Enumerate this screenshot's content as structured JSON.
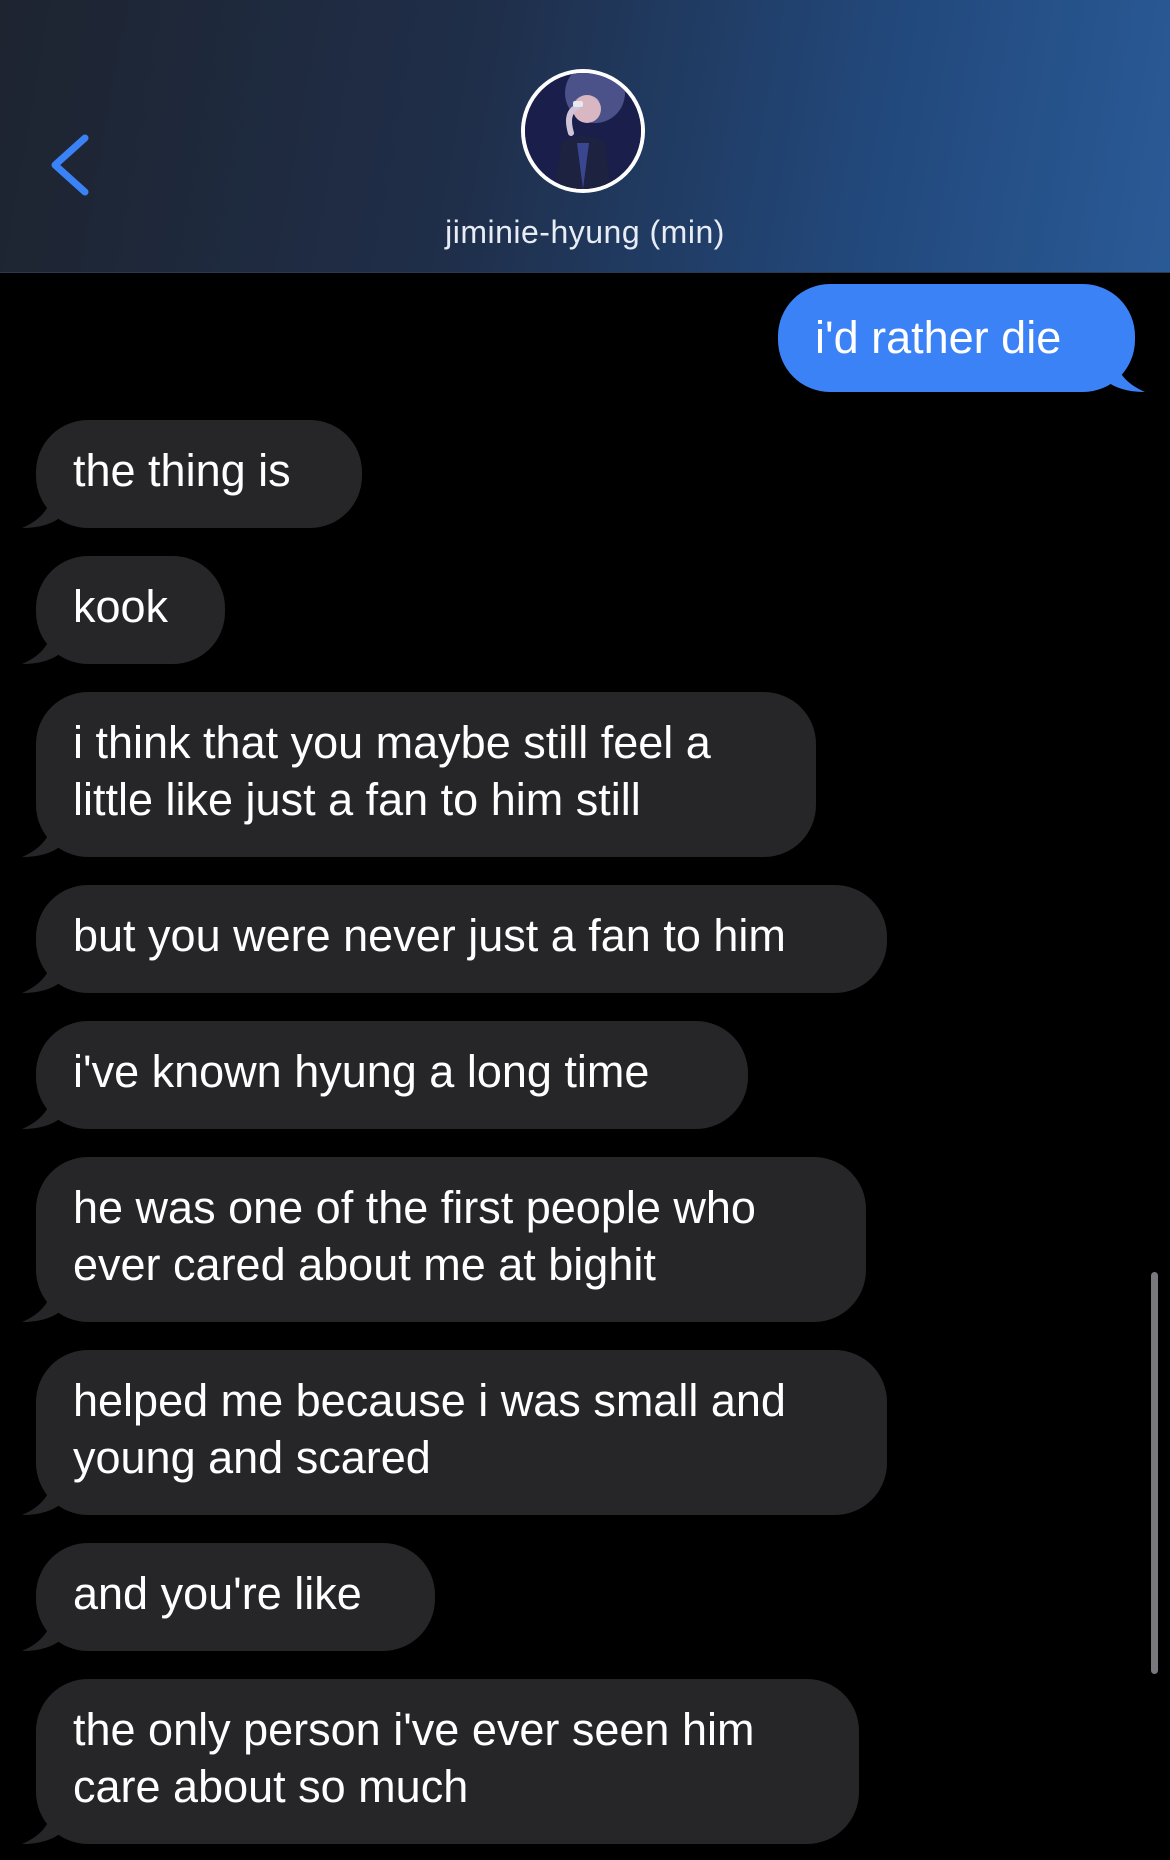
{
  "header": {
    "contact_name": "jiminie-hyung (min)",
    "back_icon": "chevron-left-icon",
    "accent_color": "#3b82f6"
  },
  "messages": [
    {
      "direction": "outgoing",
      "text": "i'd rather die"
    },
    {
      "direction": "incoming",
      "text": "the thing is"
    },
    {
      "direction": "incoming",
      "text": "kook"
    },
    {
      "direction": "incoming",
      "lines": [
        "i think that you maybe still feel a",
        "little like just a fan to him still"
      ]
    },
    {
      "direction": "incoming",
      "text": "but you were never just a fan to him"
    },
    {
      "direction": "incoming",
      "text": "i've known hyung a long time"
    },
    {
      "direction": "incoming",
      "lines": [
        "he was one of the first people who",
        "ever cared about me at bighit"
      ]
    },
    {
      "direction": "incoming",
      "lines": [
        "helped me because i was small and",
        "young and scared"
      ]
    },
    {
      "direction": "incoming",
      "text": "and you're like"
    },
    {
      "direction": "incoming",
      "lines": [
        "the only person i've ever seen him",
        "care about so much"
      ]
    }
  ],
  "colors": {
    "incoming_bubble": "#262628",
    "outgoing_bubble": "#3b82f6",
    "background": "#000000"
  }
}
